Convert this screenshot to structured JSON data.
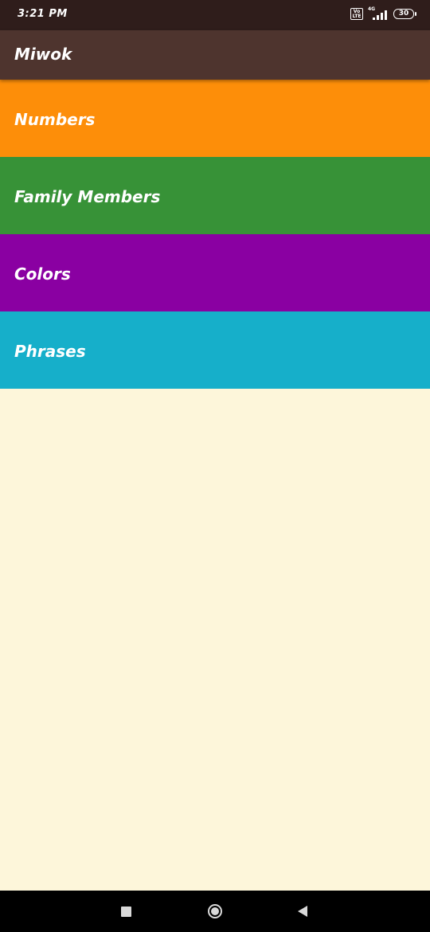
{
  "status_bar": {
    "time": "3:21 PM",
    "volte_top": "Vo",
    "volte_bottom": "LTE",
    "network_type": "4G",
    "battery_level": "30",
    "icons": [
      "volte-icon",
      "signal-icon",
      "battery-icon"
    ]
  },
  "app_bar": {
    "title": "Miwok"
  },
  "categories": [
    {
      "label": "Numbers",
      "color": "#fd8e09"
    },
    {
      "label": "Family Members",
      "color": "#379237"
    },
    {
      "label": "Colors",
      "color": "#8a00a2"
    },
    {
      "label": "Phrases",
      "color": "#16afca"
    }
  ],
  "colors": {
    "status_bar": "#2f1d1b",
    "app_bar": "#4e342e",
    "background": "#fdf6da"
  },
  "nav_bar": {
    "icons": [
      "recents-icon",
      "home-icon",
      "back-icon"
    ]
  }
}
